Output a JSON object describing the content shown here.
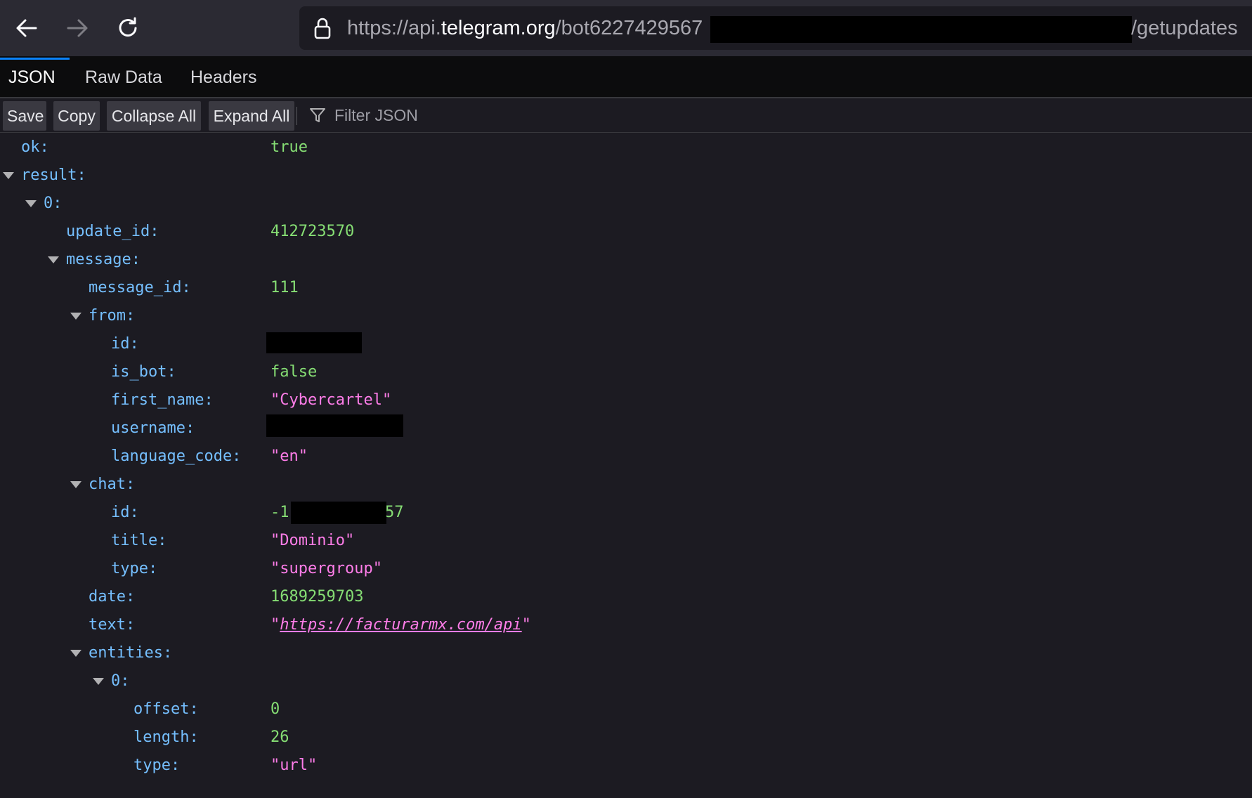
{
  "browser": {
    "url_scheme": "https://api.",
    "url_host": "telegram.org",
    "url_path_prefix": "/bot6227429567",
    "url_suffix": "/getupdates"
  },
  "tabs": [
    "JSON",
    "Raw Data",
    "Headers"
  ],
  "actions": {
    "save": "Save",
    "copy": "Copy",
    "collapse_all": "Collapse All",
    "expand_all": "Expand All",
    "filter_placeholder": "Filter JSON"
  },
  "json": {
    "ok": {
      "key": "ok:",
      "value": "true"
    },
    "result": {
      "key": "result:"
    },
    "item0": {
      "key": "0:"
    },
    "update_id": {
      "key": "update_id:",
      "value": "412723570"
    },
    "message": {
      "key": "message:"
    },
    "message_id": {
      "key": "message_id:",
      "value": "111"
    },
    "from": {
      "key": "from:"
    },
    "from_id": {
      "key": "id:"
    },
    "is_bot": {
      "key": "is_bot:",
      "value": "false"
    },
    "first_name": {
      "key": "first_name:",
      "value": "\"Cybercartel\""
    },
    "username": {
      "key": "username:"
    },
    "language_code": {
      "key": "language_code:",
      "value": "\"en\""
    },
    "chat": {
      "key": "chat:"
    },
    "chat_id": {
      "key": "id:",
      "value_prefix": "-1",
      "value_suffix": "57"
    },
    "chat_title": {
      "key": "title:",
      "value": "\"Dominio\""
    },
    "chat_type": {
      "key": "type:",
      "value": "\"supergroup\""
    },
    "date": {
      "key": "date:",
      "value": "1689259703"
    },
    "text": {
      "key": "text:",
      "quote": "\"",
      "link": "https://facturarmx.com/api"
    },
    "entities": {
      "key": "entities:"
    },
    "entity0": {
      "key": "0:"
    },
    "offset": {
      "key": "offset:",
      "value": "0"
    },
    "length": {
      "key": "length:",
      "value": "26"
    },
    "entity_type": {
      "key": "type:",
      "value": "\"url\""
    }
  }
}
